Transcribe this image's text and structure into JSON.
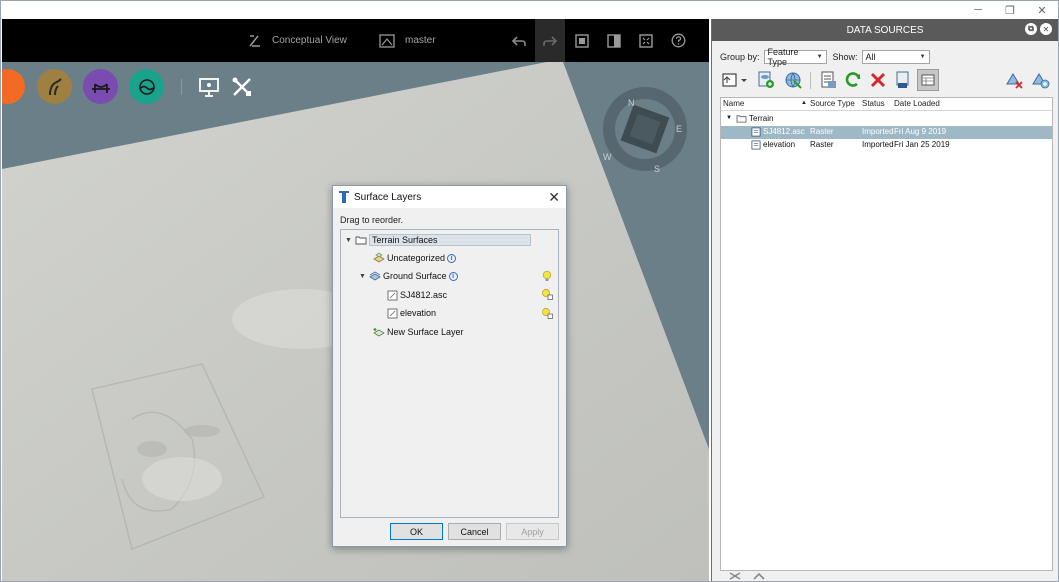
{
  "window": {
    "controls": [
      "minimize",
      "restore",
      "close"
    ],
    "control_glyphs": [
      "─",
      "❐",
      "✕"
    ]
  },
  "viewport": {
    "topbar": {
      "view_label": "Conceptual View",
      "branch_label": "master",
      "buttons": [
        "undo",
        "redo",
        "screenshot",
        "panel",
        "fullscreen",
        "help"
      ]
    },
    "tools": [
      {
        "name": "orange-tool",
        "color": "#f26a24"
      },
      {
        "name": "roads-tool",
        "color": "#a08040"
      },
      {
        "name": "bridges-tool",
        "color": "#7a4bb0"
      },
      {
        "name": "water-tool",
        "color": "#1aa38c"
      }
    ],
    "compass": {
      "n": "N",
      "e": "E",
      "s": "S",
      "w": "W"
    },
    "colors": {
      "topbar": "#000000",
      "background": "#6a7f88",
      "terrain": "#c8c8c4"
    }
  },
  "dialog": {
    "title": "Surface Layers",
    "hint": "Drag to reorder.",
    "tree": [
      {
        "label": "Terrain Surfaces",
        "selected": true
      },
      {
        "label": "Uncategorized",
        "info": "i"
      },
      {
        "label": "Ground Surface",
        "info": "i"
      },
      {
        "label": "SJ4812.asc"
      },
      {
        "label": "elevation"
      },
      {
        "label": "New Surface Layer"
      }
    ],
    "buttons": {
      "ok": "OK",
      "cancel": "Cancel",
      "apply": "Apply"
    }
  },
  "panel": {
    "title": "DATA SOURCES",
    "group_by_label": "Group by:",
    "group_by_value": "Feature Type",
    "show_label": "Show:",
    "show_value": "All",
    "columns": [
      "Name",
      "Source Type",
      "Status",
      "Date Loaded"
    ],
    "group_name": "Terrain",
    "rows": [
      {
        "name": "SJ4812.asc",
        "source_type": "Raster",
        "status": "Imported",
        "date": "Fri Aug 9 2019",
        "selected": true
      },
      {
        "name": "elevation",
        "source_type": "Raster",
        "status": "Imported",
        "date": "Fri Jan 25 2019",
        "selected": false
      }
    ],
    "colors": {
      "header": "#5a5a5a",
      "selection": "#9fb8c5"
    }
  }
}
